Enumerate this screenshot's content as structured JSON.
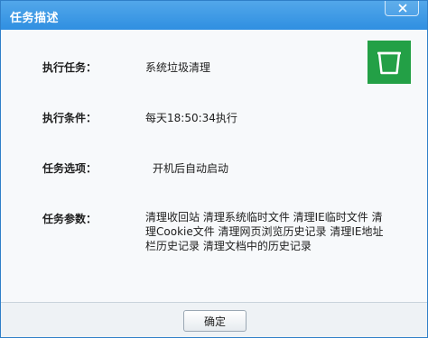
{
  "window": {
    "title": "任务描述",
    "close_icon": "close-icon"
  },
  "task": {
    "execute_task_label": "执行任务：",
    "execute_task_value": "系统垃圾清理",
    "execute_condition_label": "执行条件：",
    "execute_condition_value": "每天18:50:34执行",
    "task_options_label": "任务选项：",
    "task_options_value": "开机后自动启动",
    "task_params_label": "任务参数：",
    "task_params_value": "清理收回站 清理系统临时文件 清理IE临时文件 清理Cookie文件 清理网页浏览历史记录 清理IE地址栏历史记录 清理文档中的历史记录",
    "icon": "trash-bin-icon",
    "icon_color": "#23a046"
  },
  "footer": {
    "ok_label": "确定"
  },
  "colors": {
    "titlebar": "#3d97e4",
    "accent_green": "#23a046"
  }
}
